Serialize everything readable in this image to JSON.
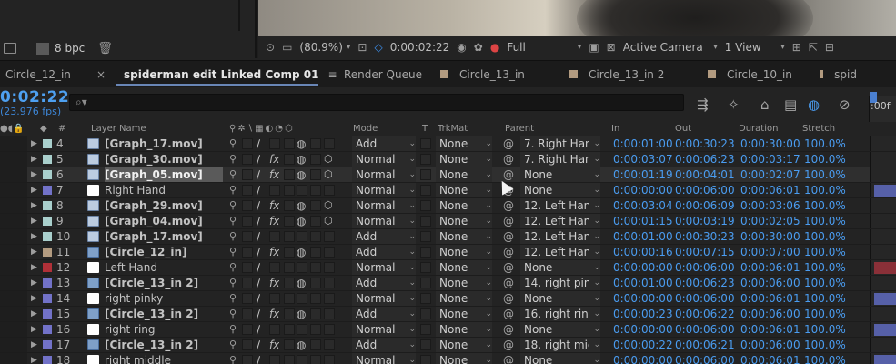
{
  "project": {
    "bpc": "8 bpc"
  },
  "viewer_bar": {
    "zoom": "(80.9%)",
    "timecode": "0:00:02:22",
    "resolution": "Full",
    "camera": "Active Camera",
    "views": "1 View"
  },
  "tabs": [
    {
      "label": "Circle_12_in",
      "swatch": false
    },
    {
      "label": "spiderman edit Linked Comp 01",
      "active": true
    },
    {
      "label": "Render Queue",
      "swatch": false
    },
    {
      "label": "Circle_13_in",
      "swatch": true
    },
    {
      "label": "Circle_13_in 2",
      "swatch": true
    },
    {
      "label": "Circle_10_in",
      "swatch": true
    },
    {
      "label": "spid",
      "swatch": true
    }
  ],
  "timeline": {
    "timecode": "0:02:22",
    "fps": "(23.976 fps)",
    "ruler_label": ":00f"
  },
  "columns": {
    "layer_name": "Layer Name",
    "mode": "Mode",
    "t": "T",
    "trkmat": "TrkMat",
    "parent": "Parent",
    "in": "In",
    "out": "Out",
    "duration": "Duration",
    "stretch": "Stretch"
  },
  "colors": {
    "timecode_blue": "#4a9cf0",
    "selection": "#5a5a5a"
  },
  "layers": [
    {
      "num": "4",
      "swatch": "#a9cfcc",
      "icon": "mov",
      "name": "[Graph_17.mov]",
      "fx": false,
      "mb": true,
      "threed": false,
      "mode": "Add",
      "trkmat": "None",
      "parent": "7. Right Han",
      "in": "0:00:01:00",
      "out": "0:00:30:23",
      "duration": "0:00:30:00",
      "stretch": "100.0%",
      "bar": ""
    },
    {
      "num": "5",
      "swatch": "#a9cfcc",
      "icon": "mov",
      "name": "[Graph_30.mov]",
      "fx": true,
      "mb": true,
      "threed": true,
      "mode": "Normal",
      "trkmat": "None",
      "parent": "7. Right Han",
      "in": "0:00:03:07",
      "out": "0:00:06:23",
      "duration": "0:00:03:17",
      "stretch": "100.0%",
      "bar": ""
    },
    {
      "num": "6",
      "swatch": "#a9cfcc",
      "icon": "mov",
      "name": "[Graph_05.mov]",
      "fx": true,
      "mb": true,
      "threed": true,
      "mode": "Normal",
      "trkmat": "None",
      "parent": "None",
      "in": "0:00:01:19",
      "out": "0:00:04:01",
      "duration": "0:00:02:07",
      "stretch": "100.0%",
      "bar": "",
      "selected": true
    },
    {
      "num": "7",
      "swatch": "#7272c8",
      "icon": "solid",
      "name": "Right Hand",
      "plain": true,
      "fx": false,
      "mb": false,
      "threed": false,
      "mode": "Normal",
      "trkmat": "None",
      "parent": "None",
      "in": "0:00:00:00",
      "out": "0:00:06:00",
      "duration": "0:00:06:01",
      "stretch": "100.0%",
      "bar": "#5660a8"
    },
    {
      "num": "8",
      "swatch": "#a9cfcc",
      "icon": "mov",
      "name": "[Graph_29.mov]",
      "fx": true,
      "mb": true,
      "threed": true,
      "mode": "Normal",
      "trkmat": "None",
      "parent": "12. Left Han",
      "in": "0:00:03:04",
      "out": "0:00:06:09",
      "duration": "0:00:03:06",
      "stretch": "100.0%",
      "bar": ""
    },
    {
      "num": "9",
      "swatch": "#a9cfcc",
      "icon": "mov",
      "name": "[Graph_04.mov]",
      "fx": true,
      "mb": true,
      "threed": true,
      "mode": "Normal",
      "trkmat": "None",
      "parent": "12. Left Han",
      "in": "0:00:01:15",
      "out": "0:00:03:19",
      "duration": "0:00:02:05",
      "stretch": "100.0%",
      "bar": ""
    },
    {
      "num": "10",
      "swatch": "#a9cfcc",
      "icon": "mov",
      "name": "[Graph_17.mov]",
      "fx": false,
      "mb": false,
      "threed": false,
      "mode": "Add",
      "trkmat": "None",
      "parent": "12. Left Han",
      "in": "0:00:01:00",
      "out": "0:00:30:23",
      "duration": "0:00:30:00",
      "stretch": "100.0%",
      "bar": ""
    },
    {
      "num": "11",
      "swatch": "#b29b80",
      "icon": "comp",
      "name": "[Circle_12_in]",
      "fx": true,
      "mb": true,
      "threed": false,
      "mode": "Add",
      "trkmat": "None",
      "parent": "12. Left Han",
      "in": "0:00:00:16",
      "out": "0:00:07:15",
      "duration": "0:00:07:00",
      "stretch": "100.0%",
      "bar": ""
    },
    {
      "num": "12",
      "swatch": "#b03038",
      "icon": "solid",
      "name": "Left Hand",
      "plain": true,
      "fx": false,
      "mb": false,
      "threed": false,
      "mode": "Normal",
      "trkmat": "None",
      "parent": "None",
      "in": "0:00:00:00",
      "out": "0:00:06:00",
      "duration": "0:00:06:01",
      "stretch": "100.0%",
      "bar": "#8a3038"
    },
    {
      "num": "13",
      "swatch": "#7272c8",
      "icon": "comp",
      "name": "[Circle_13_in 2]",
      "fx": true,
      "mb": true,
      "threed": false,
      "mode": "Add",
      "trkmat": "None",
      "parent": "14. right pin",
      "in": "0:00:01:00",
      "out": "0:00:06:23",
      "duration": "0:00:06:00",
      "stretch": "100.0%",
      "bar": ""
    },
    {
      "num": "14",
      "swatch": "#7272c8",
      "icon": "solid",
      "name": "right pinky",
      "plain": true,
      "fx": false,
      "mb": false,
      "threed": false,
      "mode": "Normal",
      "trkmat": "None",
      "parent": "None",
      "in": "0:00:00:00",
      "out": "0:00:06:00",
      "duration": "0:00:06:01",
      "stretch": "100.0%",
      "bar": "#5660a8"
    },
    {
      "num": "15",
      "swatch": "#7272c8",
      "icon": "comp",
      "name": "[Circle_13_in 2]",
      "fx": true,
      "mb": true,
      "threed": false,
      "mode": "Add",
      "trkmat": "None",
      "parent": "16. right rin",
      "in": "0:00:00:23",
      "out": "0:00:06:22",
      "duration": "0:00:06:00",
      "stretch": "100.0%",
      "bar": ""
    },
    {
      "num": "16",
      "swatch": "#7272c8",
      "icon": "solid",
      "name": "right ring",
      "plain": true,
      "fx": false,
      "mb": false,
      "threed": false,
      "mode": "Normal",
      "trkmat": "None",
      "parent": "None",
      "in": "0:00:00:00",
      "out": "0:00:06:00",
      "duration": "0:00:06:01",
      "stretch": "100.0%",
      "bar": "#5660a8"
    },
    {
      "num": "17",
      "swatch": "#7272c8",
      "icon": "comp",
      "name": "[Circle_13_in 2]",
      "fx": true,
      "mb": true,
      "threed": false,
      "mode": "Add",
      "trkmat": "None",
      "parent": "18. right mic",
      "in": "0:00:00:22",
      "out": "0:00:06:21",
      "duration": "0:00:06:00",
      "stretch": "100.0%",
      "bar": ""
    },
    {
      "num": "18",
      "swatch": "#7272c8",
      "icon": "solid",
      "name": "right middle",
      "plain": true,
      "fx": false,
      "mb": false,
      "threed": false,
      "mode": "Normal",
      "trkmat": "None",
      "parent": "None",
      "in": "0:00:00:00",
      "out": "0:00:06:00",
      "duration": "0:00:06:01",
      "stretch": "100.0%",
      "bar": "#5660a8"
    }
  ]
}
